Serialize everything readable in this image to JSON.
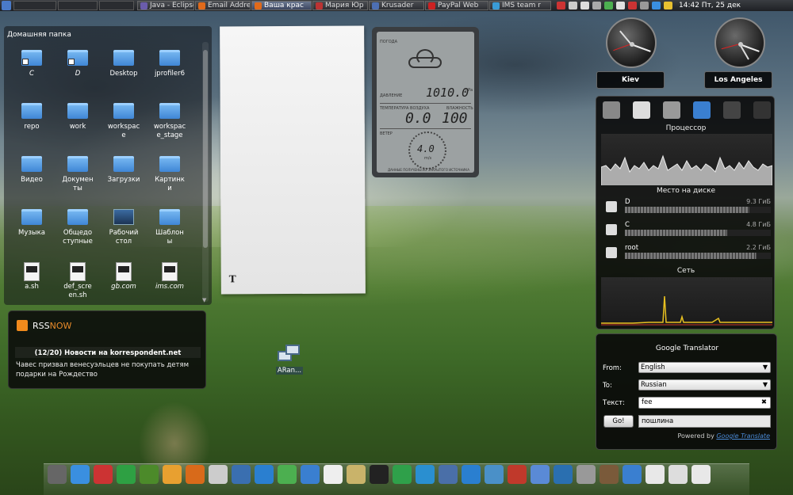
{
  "panel": {
    "tasks": [
      {
        "label": "Java - Eclipse",
        "color": "#6a5cab"
      },
      {
        "label": "Email Addre",
        "color": "#e06a1a"
      },
      {
        "label": "Ваша крас",
        "color": "#e06a1a",
        "active": true
      },
      {
        "label": "Мария Юр",
        "color": "#b33"
      },
      {
        "label": "Krusader",
        "color": "#4d6fb3"
      },
      {
        "label": "PayPal Web",
        "color": "#c22"
      },
      {
        "label": "IMS team r",
        "color": "#3a9bd6"
      }
    ],
    "clock": "14:42 Пт, 25 дек"
  },
  "folderview": {
    "title": "Домашняя папка",
    "items": [
      {
        "label": "C",
        "type": "folder-link",
        "italic": true
      },
      {
        "label": "D",
        "type": "folder-link",
        "italic": true
      },
      {
        "label": "Desktop",
        "type": "folder"
      },
      {
        "label": "jprofiler6",
        "type": "folder"
      },
      {
        "label": "repo",
        "type": "folder"
      },
      {
        "label": "work",
        "type": "folder"
      },
      {
        "label": "workspac\nе",
        "type": "folder"
      },
      {
        "label": "workspac\ne_stage",
        "type": "folder"
      },
      {
        "label": "Видео",
        "type": "folder"
      },
      {
        "label": "Докумен\nты",
        "type": "folder"
      },
      {
        "label": "Загрузки",
        "type": "folder"
      },
      {
        "label": "Картинк\nи",
        "type": "folder"
      },
      {
        "label": "Музыка",
        "type": "folder"
      },
      {
        "label": "Общедо\nступные",
        "type": "folder"
      },
      {
        "label": "Рабочий\nстол",
        "type": "desktop"
      },
      {
        "label": "Шаблон\nы",
        "type": "folder"
      },
      {
        "label": "a.sh",
        "type": "script"
      },
      {
        "label": "def_scre\nen.sh",
        "type": "script"
      },
      {
        "label": "gb.com",
        "type": "script",
        "italic": true
      },
      {
        "label": "ims.com",
        "type": "script",
        "italic": true
      }
    ]
  },
  "note": {
    "glyph": "T"
  },
  "weather": {
    "title": "ПОГОДА",
    "pressure_label": "ДАВЛЕНИЕ",
    "pressure": "1010.0",
    "pressure_unit": "hPa",
    "temp_label": "ТЕМПЕРАТУРА ВОЗДУХА",
    "temp": "0.0",
    "humid_label": "ВЛАЖНОСТЬ",
    "humid": "100",
    "wind_label": "ВЕТЕР",
    "wind": "4.0",
    "wind_unit": "m/s",
    "footer": "ДАННЫЕ ПОЛУЧЕНЫ ИЗ ЗАКРЫТОГО ИСТОЧНИКА"
  },
  "clocks": [
    {
      "city": "Kiev"
    },
    {
      "city": "Los Angeles"
    }
  ],
  "sysmon": {
    "cpu_label": "Процессор",
    "disk_label": "Место на диске",
    "disks": [
      {
        "name": "D",
        "value": "9.3 ГиБ",
        "fill": 0.85
      },
      {
        "name": "C",
        "value": "4.8 ГиБ",
        "fill": 0.7
      },
      {
        "name": "root",
        "value": "2.2 ГиБ",
        "fill": 0.9
      }
    ],
    "net_label": "Сеть"
  },
  "translator": {
    "title": "Google Translator",
    "from_label": "From:",
    "from_value": "English",
    "to_label": "To:",
    "to_value": "Russian",
    "text_label": "Текст:",
    "text_value": "fee",
    "go_label": "Go!",
    "result": "пошлина",
    "powered_prefix": "Powered by",
    "powered_link": "Google Translate"
  },
  "rss": {
    "brand_a": "RSS",
    "brand_b": "NOW",
    "headline": "(12/20) Новости на korrespondent.net",
    "body": "Чавес призвал венесуэльцев не покупать детям подарки на Рождество"
  },
  "desktop_icon": {
    "label": "ARan..."
  },
  "dock": [
    "#666",
    "#3a8fe0",
    "#c33",
    "#2ea043",
    "#4c8a2a",
    "#e8a030",
    "#d86a1a",
    "#ccc",
    "#3a6fb0",
    "#2a7fd0",
    "#4caf50",
    "#3a7fd0",
    "#eee",
    "#c9b36a",
    "#222",
    "#2fa04a",
    "#2a8fd0",
    "#4a6fa8",
    "#2a7fd0",
    "#4a90c8",
    "#c0392b",
    "#5a8ad6",
    "#2a6fb0",
    "#999",
    "#7a5a3a",
    "#3a7fd0",
    "#e8e8e8",
    "#ddd",
    "#e8e8e8"
  ]
}
